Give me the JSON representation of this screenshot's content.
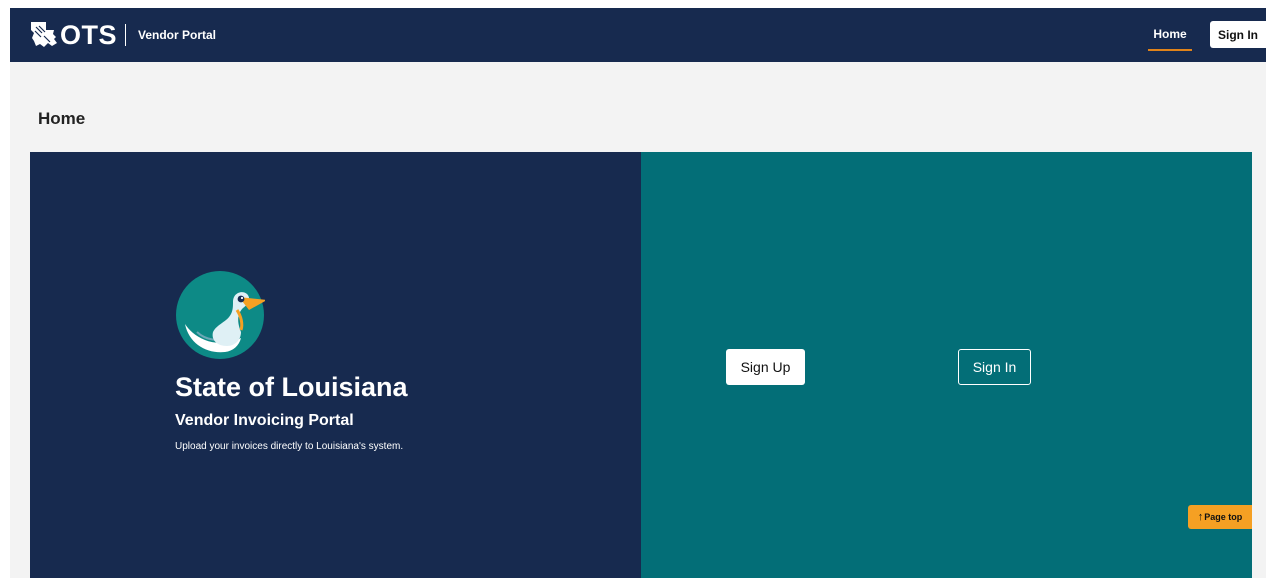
{
  "header": {
    "logo_text": "OTS",
    "portal_name": "Vendor Portal",
    "nav_home": "Home",
    "nav_signin": "Sign In"
  },
  "page": {
    "title": "Home"
  },
  "hero": {
    "title": "State of Louisiana",
    "subtitle": "Vendor Invoicing Portal",
    "description": "Upload your invoices directly to Louisiana's system.",
    "signup_label": "Sign Up",
    "signin_label": "Sign In"
  },
  "page_top": {
    "arrow": "↑",
    "label": "Page top"
  },
  "colors": {
    "navy": "#172a4f",
    "teal": "#036e77",
    "accent_orange": "#e0831a",
    "page_top_orange": "#f5a023"
  }
}
